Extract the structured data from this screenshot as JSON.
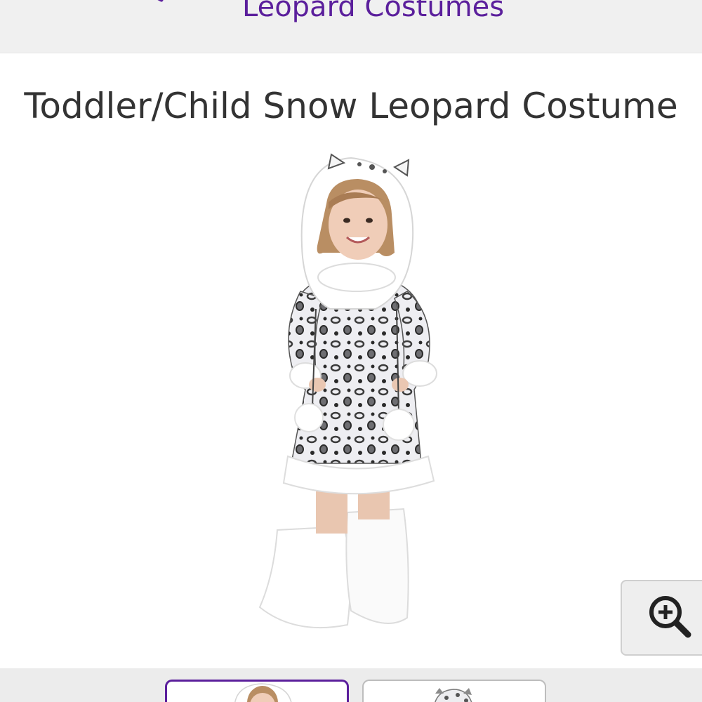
{
  "header": {
    "breadcrumb_label": "Leopard Costumes",
    "back_icon": "chevron-left-icon",
    "accent_color": "#5b1f9c"
  },
  "product": {
    "title": "Toddler/Child Snow Leopard Costume",
    "image_alt": "Girl wearing snow leopard hooded dress with white fur trim and boot covers"
  },
  "zoom": {
    "icon": "zoom-in-icon"
  },
  "thumbnails": {
    "items": [
      {
        "alt": "Front view thumbnail",
        "selected": true
      },
      {
        "alt": "Hood detail thumbnail",
        "selected": false
      }
    ]
  }
}
